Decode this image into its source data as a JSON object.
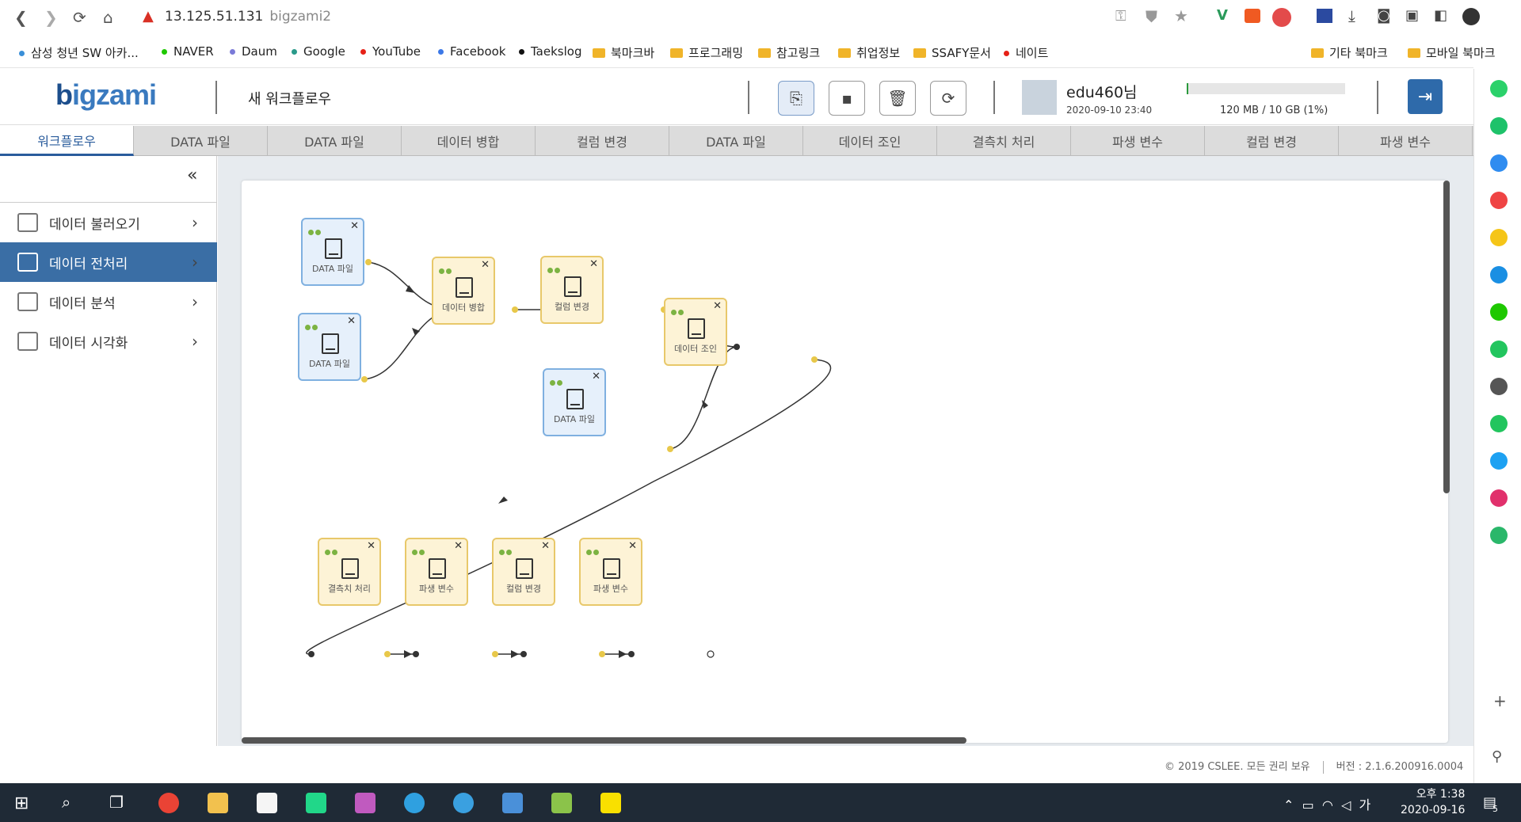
{
  "browser": {
    "url_ip": "13.125.51.131",
    "url_host": "bigzami2",
    "bookmarks": [
      {
        "label": "삼성 청년 SW 아카...",
        "color": "#3a8fd8",
        "kind": "dot"
      },
      {
        "label": "NAVER",
        "color": "#1ec800",
        "kind": "dot"
      },
      {
        "label": "Daum",
        "color": "#7a7ad8",
        "kind": "dot"
      },
      {
        "label": "Google",
        "color": "#2a9a8a",
        "kind": "dot"
      },
      {
        "label": "YouTube",
        "color": "#e62117",
        "kind": "dot"
      },
      {
        "label": "Facebook",
        "color": "#3b78e7",
        "kind": "dot"
      },
      {
        "label": "Taekslog",
        "color": "#111111",
        "kind": "dot"
      },
      {
        "label": "북마크바",
        "kind": "folder"
      },
      {
        "label": "프로그래밍",
        "kind": "folder"
      },
      {
        "label": "참고링크",
        "kind": "folder"
      },
      {
        "label": "취업정보",
        "kind": "folder"
      },
      {
        "label": "SSAFY문서",
        "kind": "folder"
      },
      {
        "label": "네이트",
        "color": "#e62117",
        "kind": "dot"
      }
    ],
    "other_bookmarks": "기타 북마크",
    "mobile_bookmarks": "모바일 북마크"
  },
  "app": {
    "logo_b": "b",
    "logo_rest": "igzami",
    "workflow_title": "새 워크플로우",
    "toolbar": {
      "new_icon": "new-workflow-icon",
      "save_icon": "save-icon",
      "delete_icon": "trash-icon",
      "refresh_icon": "refresh-icon"
    },
    "user": "edu460님",
    "user_date": "2020-09-10 23:40",
    "quota_text": "120 MB / 10 GB (1%)",
    "quota_fraction": 0.01,
    "accent": "#2e6aaa"
  },
  "tabs": [
    "워크플로우",
    "DATA 파일",
    "DATA 파일",
    "데이터 병합",
    "컬럼 변경",
    "DATA 파일",
    "데이터 조인",
    "결측치 처리",
    "파생 변수",
    "컬럼 변경",
    "파생 변수"
  ],
  "sidebar": {
    "collapse": "«",
    "items": [
      {
        "label": "데이터 불러오기",
        "chev": "›"
      },
      {
        "label": "데이터 전처리",
        "chev": "›"
      },
      {
        "label": "데이터 분석",
        "chev": "›"
      },
      {
        "label": "데이터 시각화",
        "chev": "›"
      }
    ]
  },
  "nodes": [
    {
      "label": "DATA 파일",
      "type": "src"
    },
    {
      "label": "DATA 파일",
      "type": "src"
    },
    {
      "label": "데이터 병합",
      "type": "proc"
    },
    {
      "label": "컬럼 변경",
      "type": "proc"
    },
    {
      "label": "데이터 조인",
      "type": "proc"
    },
    {
      "label": "DATA 파일",
      "type": "src"
    },
    {
      "label": "결측치 처리",
      "type": "proc"
    },
    {
      "label": "파생 변수",
      "type": "proc"
    },
    {
      "label": "컬럼 변경",
      "type": "proc"
    },
    {
      "label": "파생 변수",
      "type": "proc"
    }
  ],
  "footer": {
    "copyright": "© 2019 CSLEE. 모든 권리 보유",
    "version": "버전 : 2.1.6.200916.0004"
  },
  "taskbar": {
    "time": "오후 1:38",
    "date": "2020-09-16",
    "ime": "가",
    "notif": "5"
  }
}
